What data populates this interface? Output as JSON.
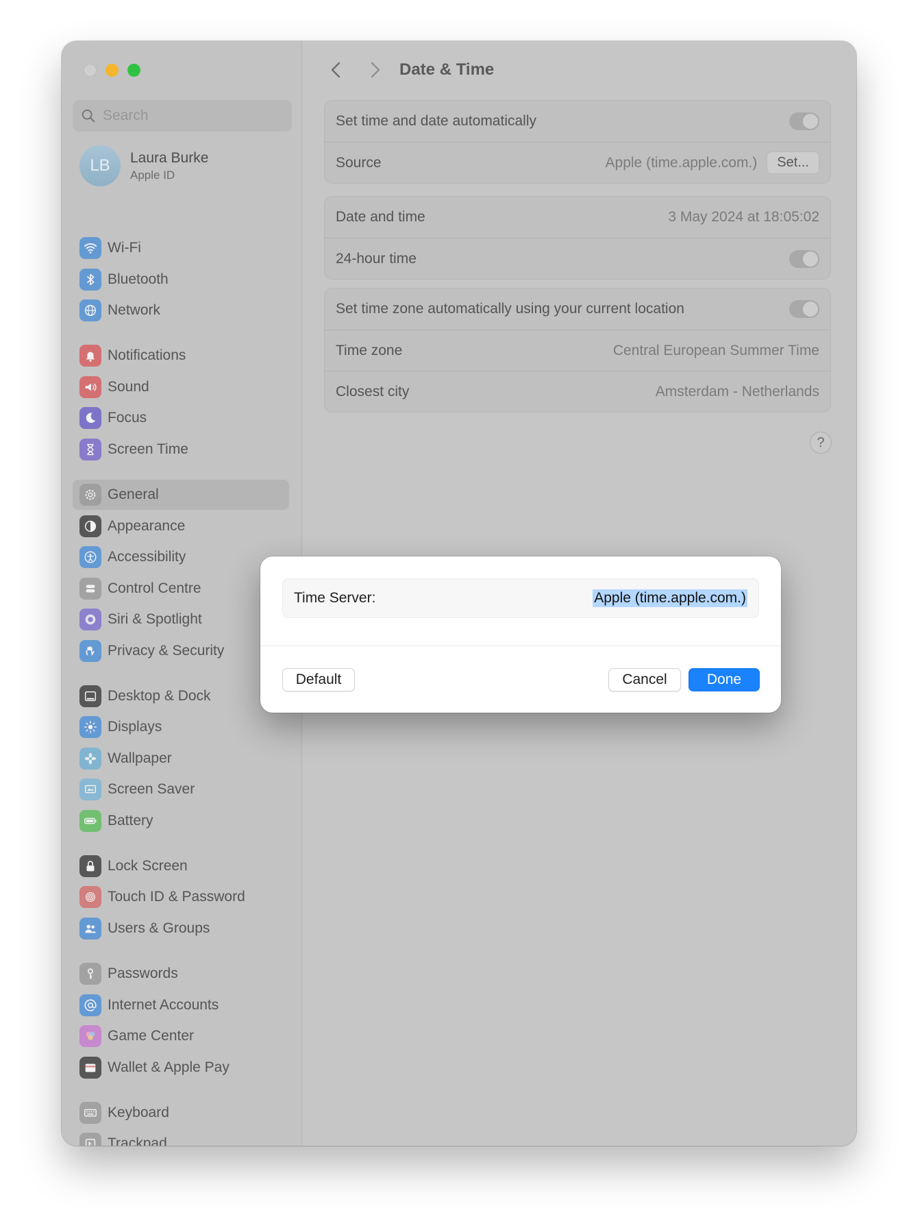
{
  "window": {
    "traffic_lights": [
      "close",
      "minimize",
      "zoom"
    ]
  },
  "sidebar": {
    "search_placeholder": "Search",
    "account": {
      "initials": "LB",
      "name": "Laura Burke",
      "subtitle": "Apple ID"
    },
    "items": [
      {
        "label": "Wi-Fi",
        "icon": "wifi-icon",
        "color": "#4a8fd9"
      },
      {
        "label": "Bluetooth",
        "icon": "bluetooth-icon",
        "color": "#4a8fd9"
      },
      {
        "label": "Network",
        "icon": "globe-icon",
        "color": "#4a8fd9"
      },
      {
        "label": "Notifications",
        "icon": "bell-icon",
        "color": "#d9595b"
      },
      {
        "label": "Sound",
        "icon": "speaker-icon",
        "color": "#d9595b"
      },
      {
        "label": "Focus",
        "icon": "moon-icon",
        "color": "#6b5fc9"
      },
      {
        "label": "Screen Time",
        "icon": "hourglass-icon",
        "color": "#7b68cc"
      },
      {
        "label": "General",
        "icon": "gear-icon",
        "color": "#9a9a9a",
        "selected": true
      },
      {
        "label": "Appearance",
        "icon": "appearance-icon",
        "color": "#3a3a3a"
      },
      {
        "label": "Accessibility",
        "icon": "accessibility-icon",
        "color": "#4a8fd9"
      },
      {
        "label": "Control Centre",
        "icon": "control-centre-icon",
        "color": "#9a9a9a"
      },
      {
        "label": "Siri & Spotlight",
        "icon": "siri-icon",
        "color": "#7d6fd1"
      },
      {
        "label": "Privacy & Security",
        "icon": "hand-icon",
        "color": "#4a8fd9"
      },
      {
        "label": "Desktop & Dock",
        "icon": "dock-icon",
        "color": "#3a3a3a"
      },
      {
        "label": "Displays",
        "icon": "sun-icon",
        "color": "#4a8fd9"
      },
      {
        "label": "Wallpaper",
        "icon": "flower-icon",
        "color": "#6fb0d6"
      },
      {
        "label": "Screen Saver",
        "icon": "screensaver-icon",
        "color": "#7ab6d9"
      },
      {
        "label": "Battery",
        "icon": "battery-icon",
        "color": "#5cbf5c"
      },
      {
        "label": "Lock Screen",
        "icon": "lock-icon",
        "color": "#3a3a3a"
      },
      {
        "label": "Touch ID & Password",
        "icon": "fingerprint-icon",
        "color": "#d56b6b"
      },
      {
        "label": "Users & Groups",
        "icon": "users-icon",
        "color": "#4a8fd9"
      },
      {
        "label": "Passwords",
        "icon": "key-icon",
        "color": "#9a9a9a"
      },
      {
        "label": "Internet Accounts",
        "icon": "at-icon",
        "color": "#4a8fd9"
      },
      {
        "label": "Game Center",
        "icon": "game-center-icon",
        "color": "#c77ad1"
      },
      {
        "label": "Wallet & Apple Pay",
        "icon": "wallet-icon",
        "color": "#3a3a3a"
      },
      {
        "label": "Keyboard",
        "icon": "keyboard-icon",
        "color": "#9a9a9a"
      },
      {
        "label": "Trackpad",
        "icon": "trackpad-icon",
        "color": "#9a9a9a"
      }
    ]
  },
  "main": {
    "title": "Date & Time",
    "groups": [
      {
        "rows": [
          {
            "label": "Set time and date automatically",
            "control": "toggle"
          },
          {
            "label": "Source",
            "value": "Apple (time.apple.com.)",
            "button": "Set..."
          }
        ]
      },
      {
        "rows": [
          {
            "label": "Date and time",
            "value": "3 May 2024 at 18:05:02"
          },
          {
            "label": "24-hour time",
            "control": "toggle"
          }
        ]
      },
      {
        "rows": [
          {
            "label": "Set time zone automatically using your current location",
            "control": "toggle"
          },
          {
            "label": "Time zone",
            "value": "Central European Summer Time"
          },
          {
            "label": "Closest city",
            "value": "Amsterdam - Netherlands"
          }
        ]
      }
    ],
    "help": "?"
  },
  "dialog": {
    "field_label": "Time Server:",
    "field_value": "Apple (time.apple.com.)",
    "default_button": "Default",
    "cancel_button": "Cancel",
    "done_button": "Done",
    "accent": "#1a82fb"
  }
}
